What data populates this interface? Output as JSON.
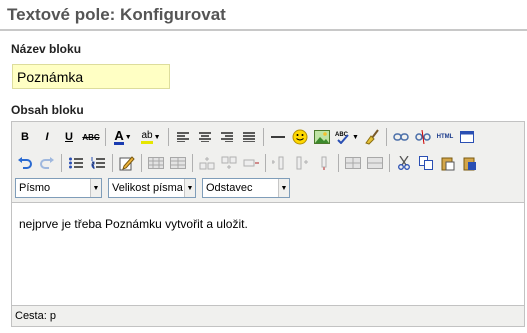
{
  "page_title": "Textové pole: Konfigurovat",
  "block_name": {
    "label": "Název bloku",
    "value": "Poznámka"
  },
  "block_content": {
    "label": "Obsah bloku"
  },
  "toolbar": {
    "bold": "B",
    "italic": "I",
    "underline": "U",
    "strike": "ABC",
    "font_color": "A",
    "highlight": "ab",
    "html": "HTML"
  },
  "selects": {
    "font": "Písmo",
    "font_size": "Velikost písma",
    "format": "Odstavec"
  },
  "editor": {
    "content": "nejprve je třeba Poznámku vytvořit a uložit.",
    "path": "Cesta: p"
  },
  "colors": {
    "title": "#555555",
    "input_bg": "#ffffc4",
    "toolbar_bg": "#f0f0ee"
  }
}
